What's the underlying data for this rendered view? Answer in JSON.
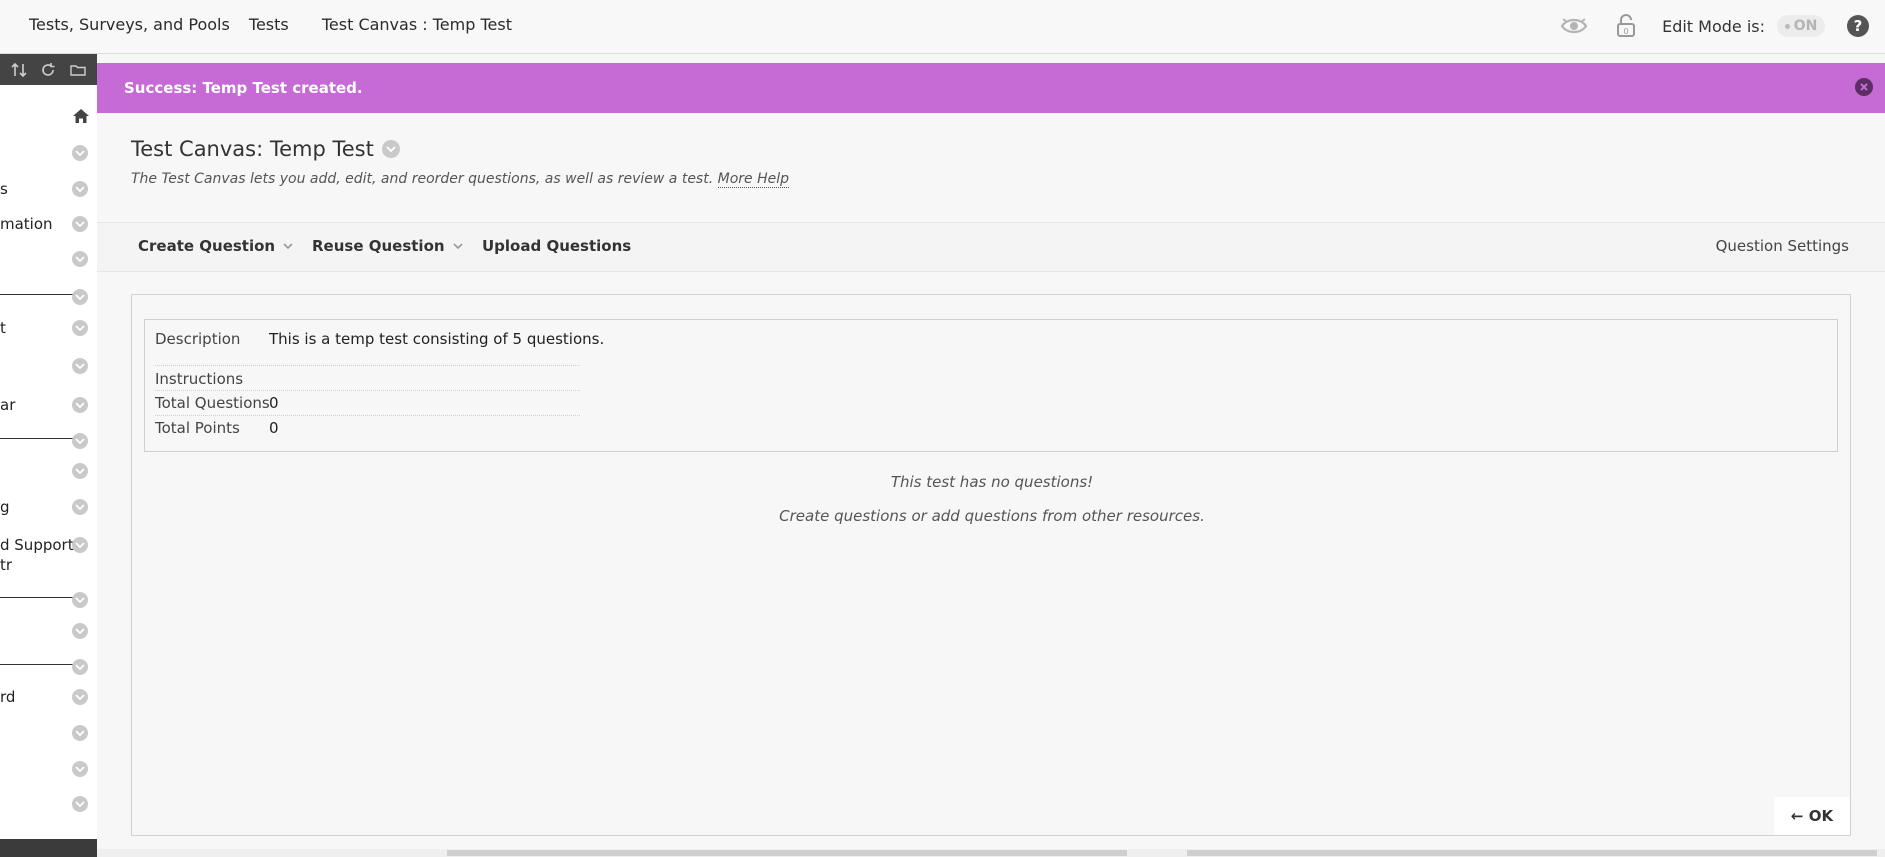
{
  "breadcrumb": {
    "items": [
      "Tests, Surveys, and Pools",
      "Tests",
      "Test Canvas : Temp Test"
    ]
  },
  "topright": {
    "edit_mode_label": "Edit Mode is:",
    "edit_mode_value": "ON",
    "help_label": "?"
  },
  "leftnav": {
    "items": [
      {
        "label": ""
      },
      {
        "label": "s"
      },
      {
        "label": "mation"
      },
      {
        "label": ""
      },
      {
        "label": ""
      },
      {
        "label": "t"
      },
      {
        "label": ""
      },
      {
        "label": "ar"
      },
      {
        "label": ""
      },
      {
        "label": ""
      },
      {
        "label": "g"
      },
      {
        "label": "d Support"
      },
      {
        "label": "tr"
      },
      {
        "label": ""
      },
      {
        "label": ""
      },
      {
        "label": "rd"
      },
      {
        "label": ""
      },
      {
        "label": ""
      },
      {
        "label": ""
      }
    ]
  },
  "alert": {
    "message": "Success: Temp Test created."
  },
  "page": {
    "title": "Test Canvas: Temp Test",
    "description": "The Test Canvas lets you add, edit, and reorder questions, as well as review a test.",
    "more_help": "More Help"
  },
  "actions": {
    "create_question": "Create Question",
    "reuse_question": "Reuse Question",
    "upload_questions": "Upload Questions",
    "question_settings": "Question Settings"
  },
  "test_info": {
    "description_label": "Description",
    "description_value": "This is a temp test consisting of 5 questions.",
    "instructions_label": "Instructions",
    "instructions_value": "",
    "total_questions_label": "Total Questions",
    "total_questions_value": "0",
    "total_points_label": "Total Points",
    "total_points_value": "0"
  },
  "empty_state": {
    "line1": "This test has no questions!",
    "line2": "Create questions or add questions from other resources."
  },
  "footer": {
    "ok_label": "← OK"
  },
  "colors": {
    "success_banner": "#c66ad6",
    "toolbar_dark": "#444444"
  }
}
